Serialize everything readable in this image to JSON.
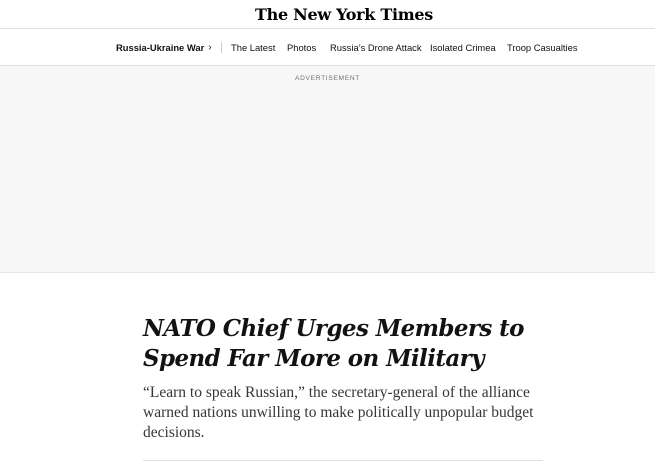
{
  "masthead": {
    "logo_text": "The New York Times"
  },
  "subnav": {
    "section_label": "Russia-Ukraine War",
    "chevron": "›",
    "links": [
      "The Latest",
      "Photos",
      "Russia’s Drone Attack",
      "Isolated Crimea",
      "Troop Casualties"
    ]
  },
  "ad": {
    "label": "ADVERTISEMENT"
  },
  "article": {
    "headline": "NATO Chief Urges Members to Spend Far More on Military",
    "summary": "“Learn to speak Russian,” the secretary-general of the alliance warned nations unwilling to make politically unpopular budget decisions."
  }
}
